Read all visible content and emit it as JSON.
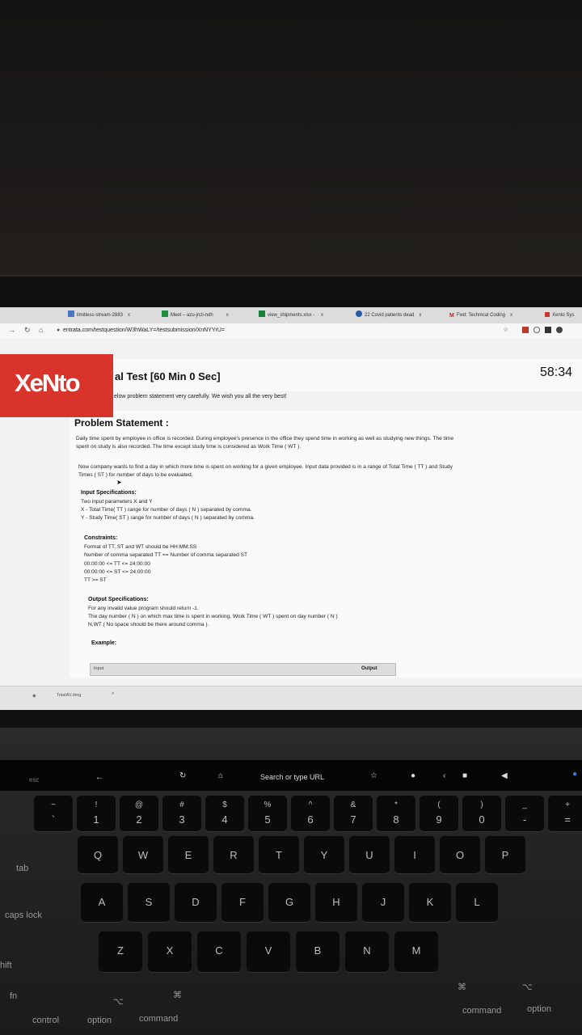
{
  "browser": {
    "tabs": [
      {
        "label": "limitless-stream-2883",
        "close": "x"
      },
      {
        "label": "Meet – azu-jnzi-ndh",
        "close": "x"
      },
      {
        "label": "view_shipments.xlsx - ",
        "close": "x"
      },
      {
        "label": "22 Covid patients dead",
        "close": "x"
      },
      {
        "label": "Fwd: Technical Coding",
        "close": "x"
      },
      {
        "label": "Xento Sys",
        "close": ""
      }
    ],
    "url": "entrata.com/testquestion/W3hWaLY=/testsubmission/XnNYYrU=",
    "star_icon": "star-icon"
  },
  "header": {
    "logo": "XeNto",
    "test_title": "al Test [60 Min 0 Sec]",
    "timer": "58:34",
    "intro": "elow problem statement very carefully. We wish you all the very best!"
  },
  "problem": {
    "title": "Problem Statement :",
    "para1_line1": "Daily time spent by employee in office is recorded. During employee's presence in the office they spend time in working as well as studying new things. The time",
    "para1_line2": "spent on study is also recorded. The time except study time is considered as Work Time ( WT ).",
    "para2_line1": "Now company wants to find a day in which more time is spent on working for a given employee. Input data provided is in a range of Total Time ( TT ) and Study",
    "para2_line2": "Times ( ST ) for number of days to be evaluated.",
    "input_spec_title": "Input Specifications:",
    "input_spec_lines": [
      "Two input parameters X and Y",
      "X - Total Time( TT ) range for number of days ( N ) separated by comma.",
      "Y - Study Time( ST ) range for number of days ( N ) separated by comma."
    ],
    "constraints_title": "Constraints:",
    "constraints_lines": [
      "Format of TT, ST and WT should be HH:MM:SS",
      "Number of comma separated TT == Number of comma separated ST",
      "00:00:00 <= TT <= 24:00:00",
      "00:00:00 <= ST <= 24:00:00",
      "TT >= ST"
    ],
    "output_spec_title": "Output Specifications:",
    "output_spec_lines": [
      "For any invalid value program should return -1.",
      "The day number ( N ) on which max time is spent in working, Work Time ( WT ) spent on day number ( N )",
      "N,WT ( No space should be there around comma )."
    ],
    "example_title": "Example:",
    "example_input_header": "Input",
    "example_output_header": "Output"
  },
  "downloads": {
    "file": "TotalAV.dmg",
    "chevron": "^"
  },
  "touchbar": {
    "esc": "esc",
    "search": "Search or type URL"
  },
  "keys": {
    "num_top": [
      "~",
      "!",
      "@",
      "#",
      "$",
      "%",
      "^",
      "&",
      "*",
      "(",
      ")",
      "_",
      "+"
    ],
    "num": [
      "`",
      "1",
      "2",
      "3",
      "4",
      "5",
      "6",
      "7",
      "8",
      "9",
      "0",
      "-",
      "="
    ],
    "row_q": [
      "Q",
      "W",
      "E",
      "R",
      "T",
      "Y",
      "U",
      "I",
      "O",
      "P"
    ],
    "row_a": [
      "A",
      "S",
      "D",
      "F",
      "G",
      "H",
      "J",
      "K",
      "L"
    ],
    "row_z": [
      "Z",
      "X",
      "C",
      "V",
      "B",
      "N",
      "M"
    ],
    "tab": "tab",
    "caps": "caps lock",
    "shift": "hift",
    "fn": "fn",
    "control": "control",
    "option_l": "option",
    "command_l": "command",
    "command_r": "command",
    "option_r": "option"
  }
}
